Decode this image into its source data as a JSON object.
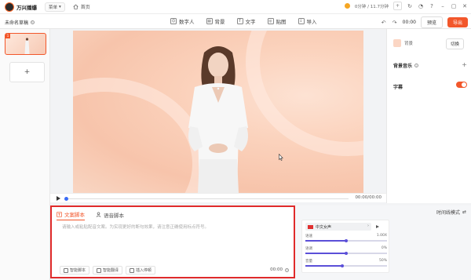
{
  "app": {
    "name": "万兴播爆",
    "menu_label": "菜单",
    "home_label": "首页"
  },
  "account": {
    "usage": "0分钟 / 11.7分钟"
  },
  "toolbar": {
    "draft_title": "未命名草稿",
    "items": [
      {
        "label": "数字人",
        "icon": "person-icon"
      },
      {
        "label": "背景",
        "icon": "background-icon"
      },
      {
        "label": "文字",
        "icon": "text-icon"
      },
      {
        "label": "贴图",
        "icon": "sticker-icon"
      },
      {
        "label": "导入",
        "icon": "import-icon"
      }
    ],
    "timecode": "00:00",
    "preview_label": "预览",
    "export_label": "导出"
  },
  "scenes": {
    "items": [
      {
        "number": "1"
      }
    ],
    "add_label": "+"
  },
  "player": {
    "time": "00:00/00:00",
    "progress": 0
  },
  "right_panel": {
    "background_label": "背景",
    "switch_label": "切换",
    "bgm_label": "背景音乐",
    "subtitle_label": "字幕",
    "subtitle_on": true
  },
  "script": {
    "tabs": [
      {
        "label": "文案脚本",
        "active": true
      },
      {
        "label": "语音脚本",
        "active": false
      }
    ],
    "placeholder": "请输入或粘贴配音文案。为实现更好的断句效果，请注意正确使用标点符号。",
    "actions": [
      "智能脚本",
      "智能翻译",
      "插入停顿"
    ],
    "duration": "00:00"
  },
  "tts": {
    "mode_label": "时间线模式",
    "voice": "中文女声",
    "sliders": [
      {
        "label": "语速",
        "value": "1.00X",
        "fraction": 0.5
      },
      {
        "label": "语调",
        "value": "0%",
        "fraction": 0.5
      },
      {
        "label": "音量",
        "value": "50%",
        "fraction": 0.45
      }
    ]
  },
  "colors": {
    "accent": "#f2572b",
    "highlight_border": "#e02b2b",
    "slider": "#5b4fd8"
  }
}
